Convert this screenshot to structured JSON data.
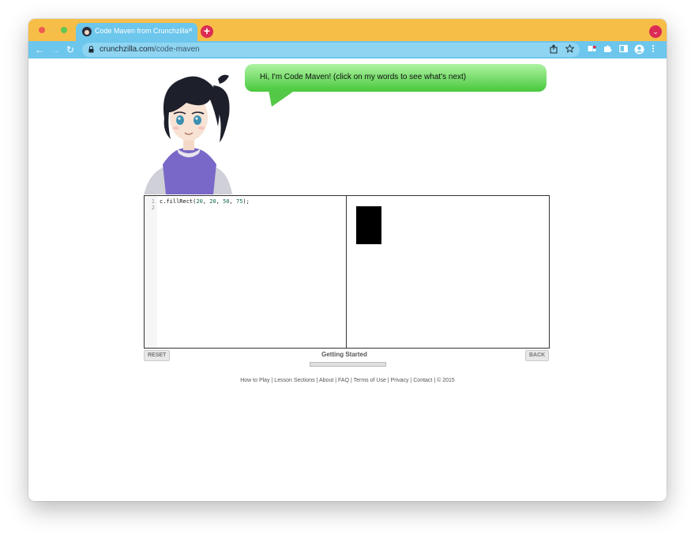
{
  "browser": {
    "tab_title": "Code Maven from Crunchzilla",
    "tab_close": "×",
    "new_tab": "+",
    "profile_menu": "⌄",
    "nav_back": "←",
    "nav_forward": "→",
    "nav_reload": "↻",
    "url_host": "crunchzilla.com",
    "url_path": "/code-maven",
    "icons": [
      "share-icon",
      "bookmark-star-icon",
      "extension-icon",
      "puzzle-icon",
      "sidebar-icon",
      "account-icon",
      "more-icon"
    ],
    "colors": {
      "tabbar": "#f6be47",
      "toolbar": "#6dc6ec",
      "accent": "#dc2c54"
    }
  },
  "speech": {
    "text": "Hi, I'm Code Maven! (click on my words to see what's next)"
  },
  "editor": {
    "line_numbers": [
      "1",
      "2"
    ],
    "code": {
      "prefix": "c.fillRect(",
      "args": [
        "20",
        "20",
        "50",
        "75"
      ],
      "suffix": ");"
    }
  },
  "controls": {
    "reset": "RESET",
    "back": "BACK",
    "lesson_title": "Getting Started"
  },
  "footer": {
    "links": [
      "How to Play",
      "Lesson Sections",
      "About",
      "FAQ",
      "Terms of Use",
      "Privacy",
      "Contact"
    ],
    "copyright": "© 2015",
    "separator": " | "
  }
}
